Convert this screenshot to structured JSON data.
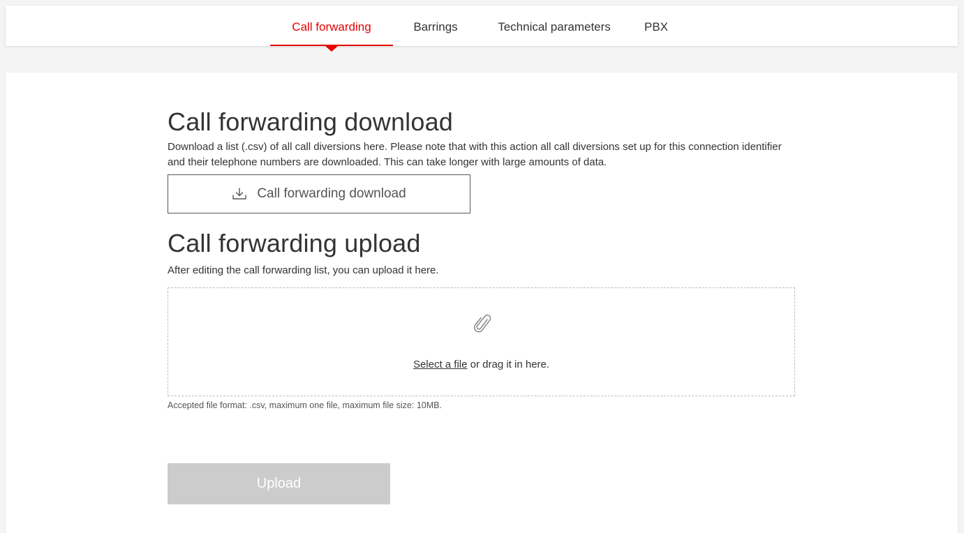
{
  "tabs": [
    {
      "label": "Call forwarding",
      "active": true
    },
    {
      "label": "Barrings",
      "active": false
    },
    {
      "label": "Technical parameters",
      "active": false
    },
    {
      "label": "PBX",
      "active": false
    }
  ],
  "colors": {
    "accent": "#e60000",
    "disabled_button": "#cccccc"
  },
  "download_section": {
    "title": "Call forwarding download",
    "description": "Download a list (.csv) of all call diversions here. Please note that with this action all call diversions set up for this connection identifier and their telephone numbers are downloaded. This can take longer with large amounts of data.",
    "button_label": "Call forwarding download",
    "button_icon": "download-icon"
  },
  "upload_section": {
    "title": "Call forwarding upload",
    "description": "After editing the call forwarding list, you can upload it here.",
    "dropzone_icon": "paperclip-icon",
    "select_file_link": "Select a file",
    "drop_text_suffix": " or drag it in here.",
    "hint": "Accepted file format: .csv, maximum one file, maximum file size: 10MB.",
    "upload_button_label": "Upload",
    "upload_button_disabled": true
  }
}
